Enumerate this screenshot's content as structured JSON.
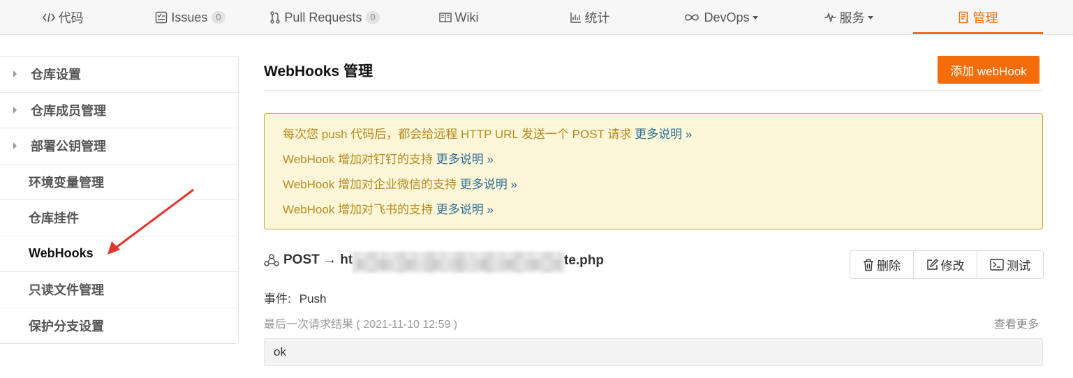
{
  "topnav": {
    "tabs": [
      {
        "label": "代码",
        "icon": "code-icon"
      },
      {
        "label": "Issues",
        "icon": "issues-icon",
        "badge": "0"
      },
      {
        "label": "Pull Requests",
        "icon": "pull-request-icon",
        "badge": "0"
      },
      {
        "label": "Wiki",
        "icon": "wiki-icon"
      },
      {
        "label": "统计",
        "icon": "stats-icon"
      },
      {
        "label": "DevOps",
        "icon": "infinity-icon",
        "dropdown": true
      },
      {
        "label": "服务",
        "icon": "pulse-icon",
        "dropdown": true
      },
      {
        "label": "管理",
        "icon": "manage-icon",
        "active": true
      }
    ],
    "accent_color": "#f56c0a"
  },
  "sidebar": {
    "items": [
      {
        "label": "仓库设置",
        "expandable": true
      },
      {
        "label": "仓库成员管理",
        "expandable": true
      },
      {
        "label": "部署公钥管理",
        "expandable": true
      },
      {
        "label": "环境变量管理",
        "expandable": false
      },
      {
        "label": "仓库挂件",
        "expandable": false
      },
      {
        "label": "WebHooks",
        "expandable": false,
        "active": true
      },
      {
        "label": "只读文件管理",
        "expandable": false
      },
      {
        "label": "保护分支设置",
        "expandable": false
      }
    ]
  },
  "main": {
    "title": "WebHooks 管理",
    "add_button": "添加 webHook",
    "notice": {
      "lines": [
        {
          "text": "每次您 push 代码后，都会给远程 HTTP URL 发送一个 POST 请求",
          "link": "更多说明 »"
        },
        {
          "text": "WebHook 增加对钉钉的支持",
          "link": "更多说明 »"
        },
        {
          "text": "WebHook 增加对企业微信的支持",
          "link": "更多说明 »"
        },
        {
          "text": "WebHook 增加对飞书的支持",
          "link": "更多说明 »"
        }
      ]
    },
    "hook": {
      "method_prefix": "POST → ht",
      "url_tail": "te.php",
      "actions": {
        "delete": "删除",
        "edit": "修改",
        "test": "测试"
      },
      "event_label": "事件:",
      "event_value": "Push",
      "last_request": "最后一次请求结果 ( 2021-11-10 12:59 )",
      "view_more": "查看更多",
      "result": "ok"
    }
  }
}
